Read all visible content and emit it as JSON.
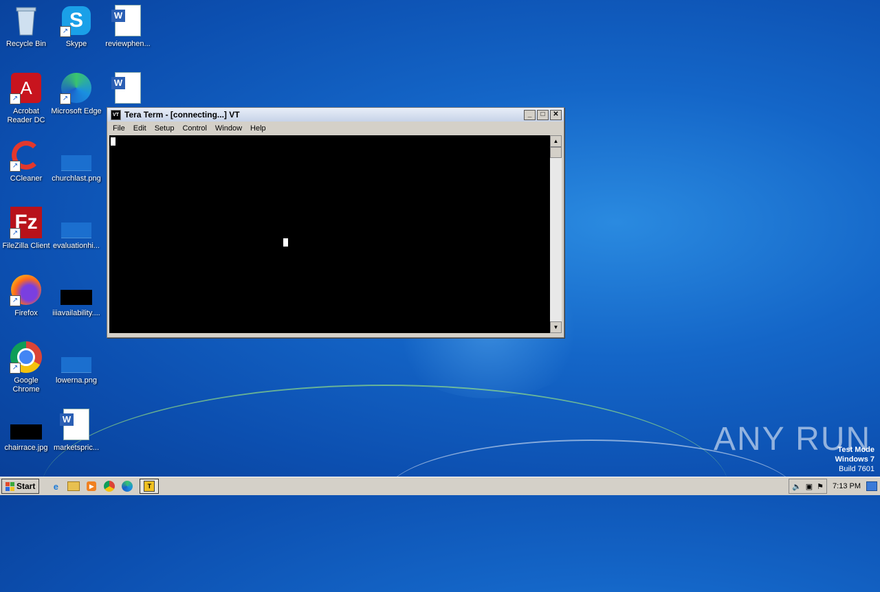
{
  "desktop": {
    "icons": [
      {
        "label": "Recycle Bin"
      },
      {
        "label": "Skype"
      },
      {
        "label": "reviewphen..."
      },
      {
        "label": "Acrobat Reader DC"
      },
      {
        "label": "Microsoft Edge"
      },
      {
        "label": ""
      },
      {
        "label": "CCleaner"
      },
      {
        "label": "churchlast.png"
      },
      {
        "label": "FileZilla Client"
      },
      {
        "label": "evaluationhi..."
      },
      {
        "label": "Firefox"
      },
      {
        "label": "iiiavailability...."
      },
      {
        "label": "Google Chrome"
      },
      {
        "label": "lowerna.png"
      },
      {
        "label": "chairrace.jpg"
      },
      {
        "label": "marketspric..."
      }
    ]
  },
  "window": {
    "title": "Tera Term - [connecting...] VT",
    "menu": [
      "File",
      "Edit",
      "Setup",
      "Control",
      "Window",
      "Help"
    ]
  },
  "taskbar": {
    "start_label": "Start",
    "clock": "7:13 PM"
  },
  "watermark": {
    "line1": "Test Mode",
    "line2": "Windows 7",
    "line3": "Build 7601",
    "brand": "ANY RUN"
  },
  "colors": {
    "desktop": "#1466c8",
    "terminal": "#000000",
    "chrome": "#d4d0c8"
  }
}
